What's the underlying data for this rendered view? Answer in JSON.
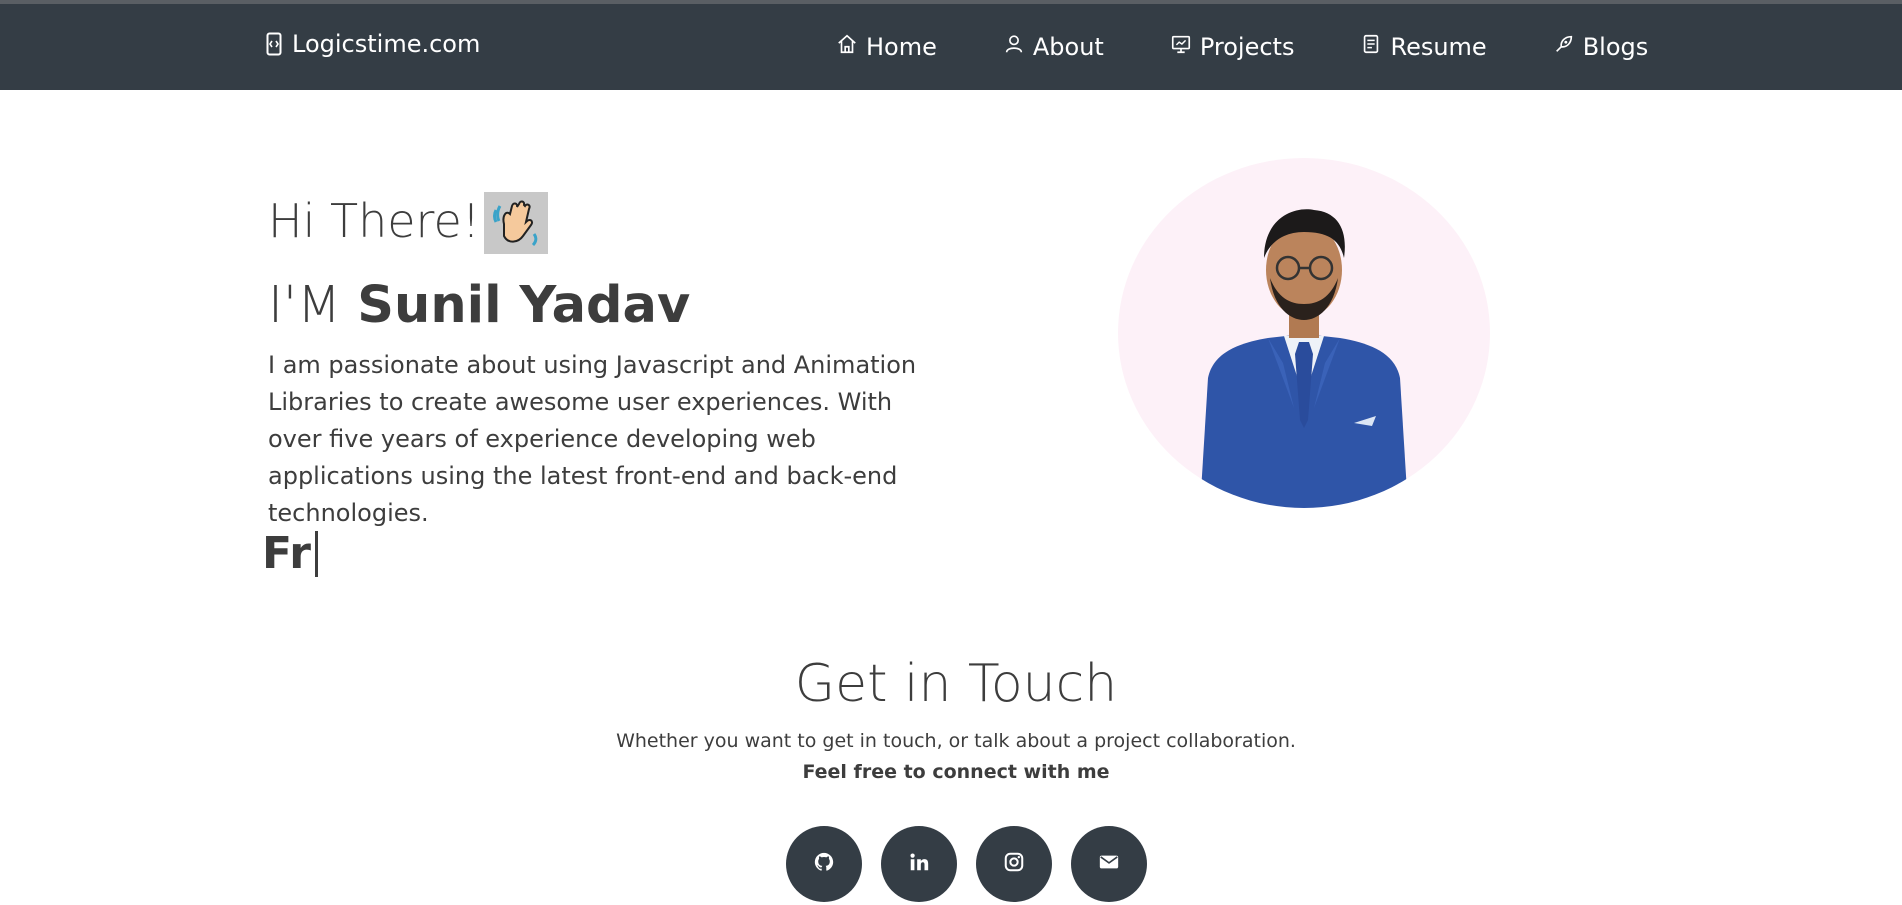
{
  "brand": {
    "name": "Logicstime.com",
    "icon": "code-file-icon"
  },
  "nav": {
    "items": [
      {
        "label": "Home",
        "icon": "home-icon"
      },
      {
        "label": "About",
        "icon": "user-icon"
      },
      {
        "label": "Projects",
        "icon": "presentation-icon"
      },
      {
        "label": "Resume",
        "icon": "document-icon"
      },
      {
        "label": "Blogs",
        "icon": "pen-icon"
      }
    ]
  },
  "hero": {
    "greeting": "Hi There!",
    "greeting_emoji": "waving-hand-icon",
    "name_prefix": "I'M",
    "name": "Sunil Yadav",
    "description": "I am passionate about using Javascript and Animation Libraries to create awesome user experiences. With over five years of experience developing web applications using the latest front-end and back-end technologies.",
    "typed_text": "Fr"
  },
  "contact": {
    "title": "Get in Touch",
    "subtitle": "Whether you want to get in touch, or talk about a project collaboration.",
    "cta": "Feel free to connect with me",
    "socials": [
      {
        "icon": "github-icon"
      },
      {
        "icon": "linkedin-icon"
      },
      {
        "icon": "instagram-icon"
      },
      {
        "icon": "email-icon"
      }
    ]
  },
  "colors": {
    "navbar_bg": "#343d45",
    "text": "#3d3d3d",
    "avatar_bg": "#fdf1f8"
  }
}
